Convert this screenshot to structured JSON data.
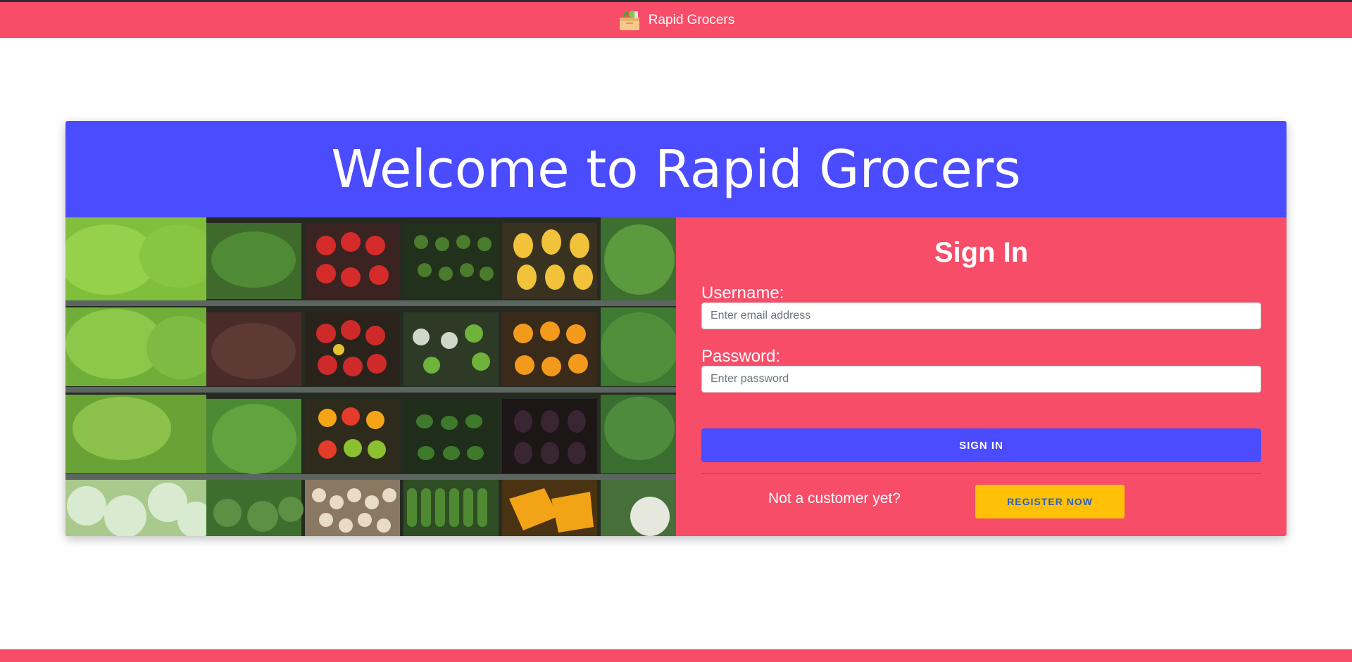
{
  "navbar": {
    "brand_text": "Rapid Grocers",
    "brand_icon": "grocery-basket-icon",
    "color": "#f74d69"
  },
  "hero": {
    "title": "Welcome to Rapid Grocers",
    "color": "#4b4bff"
  },
  "image": {
    "subject": "produce-shelves-photo"
  },
  "signin": {
    "title": "Sign In",
    "username_label": "Username:",
    "username_placeholder": "Enter email address",
    "password_label": "Password:",
    "password_placeholder": "Enter password",
    "submit_label": "SIGN IN",
    "prompt": "Not a customer yet?",
    "register_label": "REGISTER NOW",
    "panel_color": "#f74d69",
    "submit_color": "#4b4bff",
    "register_color": "#ffc107"
  }
}
